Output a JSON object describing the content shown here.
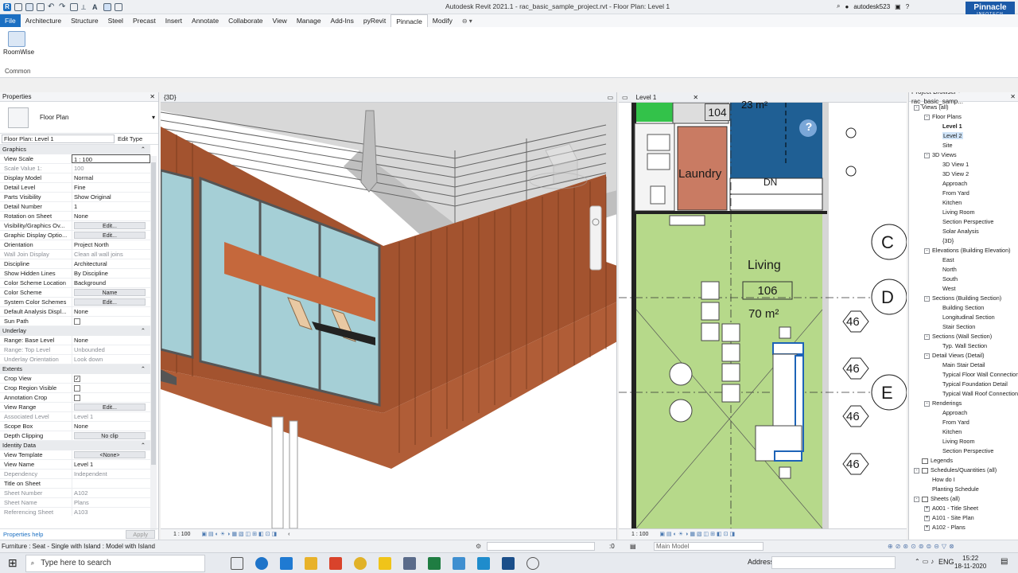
{
  "app": {
    "title": "Autodesk Revit 2021.1 - rac_basic_sample_project.rvt - Floor Plan: Level 1",
    "user": "autodesk523",
    "brand": "Pinnacle",
    "brand_sub": "INFOTECH"
  },
  "tabs": [
    "Architecture",
    "Structure",
    "Steel",
    "Precast",
    "Insert",
    "Annotate",
    "Collaborate",
    "View",
    "Manage",
    "Add-Ins",
    "pyRevit",
    "Pinnacle",
    "Modify"
  ],
  "file_tab": "File",
  "active_tab": "Pinnacle",
  "ribbon": {
    "tool_label": "RoomWise",
    "panel_label": "Common"
  },
  "properties": {
    "header": "Properties",
    "type_name": "Floor Plan",
    "selector": "Floor Plan: Level 1",
    "edit_type": "Edit Type",
    "sections": [
      {
        "name": "Graphics",
        "rows": [
          {
            "n": "View Scale",
            "v": "1 : 100",
            "kind": "input"
          },
          {
            "n": "Scale Value    1:",
            "v": "100",
            "kind": "grey"
          },
          {
            "n": "Display Model",
            "v": "Normal"
          },
          {
            "n": "Detail Level",
            "v": "Fine"
          },
          {
            "n": "Parts Visibility",
            "v": "Show Original"
          },
          {
            "n": "Detail Number",
            "v": "1"
          },
          {
            "n": "Rotation on Sheet",
            "v": "None"
          },
          {
            "n": "Visibility/Graphics Ov...",
            "v": "Edit...",
            "kind": "btn"
          },
          {
            "n": "Graphic Display Optio...",
            "v": "Edit...",
            "kind": "btn"
          },
          {
            "n": "Orientation",
            "v": "Project North"
          },
          {
            "n": "Wall Join Display",
            "v": "Clean all wall joins",
            "kind": "grey"
          },
          {
            "n": "Discipline",
            "v": "Architectural"
          },
          {
            "n": "Show Hidden Lines",
            "v": "By Discipline"
          },
          {
            "n": "Color Scheme Location",
            "v": "Background"
          },
          {
            "n": "Color Scheme",
            "v": "Name",
            "kind": "btn"
          },
          {
            "n": "System Color Schemes",
            "v": "Edit...",
            "kind": "btn"
          },
          {
            "n": "Default Analysis Displ...",
            "v": "None"
          },
          {
            "n": "Sun Path",
            "v": "",
            "kind": "check"
          }
        ]
      },
      {
        "name": "Underlay",
        "rows": [
          {
            "n": "Range: Base Level",
            "v": "None"
          },
          {
            "n": "Range: Top Level",
            "v": "Unbounded",
            "kind": "grey"
          },
          {
            "n": "Underlay Orientation",
            "v": "Look down",
            "kind": "grey"
          }
        ]
      },
      {
        "name": "Extents",
        "rows": [
          {
            "n": "Crop View",
            "v": "",
            "kind": "checked"
          },
          {
            "n": "Crop Region Visible",
            "v": "",
            "kind": "check"
          },
          {
            "n": "Annotation Crop",
            "v": "",
            "kind": "check"
          },
          {
            "n": "View Range",
            "v": "Edit...",
            "kind": "btn"
          },
          {
            "n": "Associated Level",
            "v": "Level 1",
            "kind": "grey"
          },
          {
            "n": "Scope Box",
            "v": "None"
          },
          {
            "n": "Depth Clipping",
            "v": "No clip",
            "kind": "btn"
          }
        ]
      },
      {
        "name": "Identity Data",
        "rows": [
          {
            "n": "View Template",
            "v": "<None>",
            "kind": "btn"
          },
          {
            "n": "View Name",
            "v": "Level 1"
          },
          {
            "n": "Dependency",
            "v": "Independent",
            "kind": "grey"
          },
          {
            "n": "Title on Sheet",
            "v": ""
          },
          {
            "n": "Sheet Number",
            "v": "A102",
            "kind": "grey"
          },
          {
            "n": "Sheet Name",
            "v": "Plans",
            "kind": "grey"
          },
          {
            "n": "Referencing Sheet",
            "v": "A103",
            "kind": "grey"
          }
        ]
      }
    ],
    "help_link": "Properties help",
    "apply": "Apply"
  },
  "view3d": {
    "tab": "{3D}",
    "scale": "1 : 100"
  },
  "viewplan": {
    "tab": "Level 1",
    "scale": "1 : 100",
    "laundry": "Laundry",
    "dn": "DN",
    "top_tag": "104",
    "area_top": "23 m²",
    "room_name": "Living",
    "room_number": "106",
    "room_area": "70 m²",
    "grid_c": "C",
    "grid_d": "D",
    "grid_e": "E",
    "tag_46": "46",
    "help": "?"
  },
  "browser": {
    "header": "Project Browser - rac_basic_samp...",
    "tree": [
      {
        "t": "Views (all)",
        "l": 0,
        "tog": "-"
      },
      {
        "t": "Floor Plans",
        "l": 1,
        "tog": "-"
      },
      {
        "t": "Level 1",
        "l": 2,
        "b": true
      },
      {
        "t": "Level 2",
        "l": 2,
        "sel": true
      },
      {
        "t": "Site",
        "l": 2
      },
      {
        "t": "3D Views",
        "l": 1,
        "tog": "-"
      },
      {
        "t": "3D View 1",
        "l": 2
      },
      {
        "t": "3D View 2",
        "l": 2
      },
      {
        "t": "Approach",
        "l": 2
      },
      {
        "t": "From Yard",
        "l": 2
      },
      {
        "t": "Kitchen",
        "l": 2
      },
      {
        "t": "Living Room",
        "l": 2
      },
      {
        "t": "Section Perspective",
        "l": 2
      },
      {
        "t": "Solar Analysis",
        "l": 2
      },
      {
        "t": "{3D}",
        "l": 2
      },
      {
        "t": "Elevations (Building Elevation)",
        "l": 1,
        "tog": "-"
      },
      {
        "t": "East",
        "l": 2
      },
      {
        "t": "North",
        "l": 2
      },
      {
        "t": "South",
        "l": 2
      },
      {
        "t": "West",
        "l": 2
      },
      {
        "t": "Sections (Building Section)",
        "l": 1,
        "tog": "-"
      },
      {
        "t": "Building Section",
        "l": 2
      },
      {
        "t": "Longitudinal Section",
        "l": 2
      },
      {
        "t": "Stair Section",
        "l": 2
      },
      {
        "t": "Sections (Wall Section)",
        "l": 1,
        "tog": "-"
      },
      {
        "t": "Typ. Wall Section",
        "l": 2
      },
      {
        "t": "Detail Views (Detail)",
        "l": 1,
        "tog": "-"
      },
      {
        "t": "Main Stair Detail",
        "l": 2
      },
      {
        "t": "Typical Floor Wall Connection",
        "l": 2
      },
      {
        "t": "Typical Foundation Detail",
        "l": 2
      },
      {
        "t": "Typical Wall Roof Connection",
        "l": 2
      },
      {
        "t": "Renderings",
        "l": 1,
        "tog": "-"
      },
      {
        "t": "Approach",
        "l": 2
      },
      {
        "t": "From Yard",
        "l": 2
      },
      {
        "t": "Kitchen",
        "l": 2
      },
      {
        "t": "Living Room",
        "l": 2
      },
      {
        "t": "Section Perspective",
        "l": 2
      },
      {
        "t": "Legends",
        "l": 0,
        "icon": true
      },
      {
        "t": "Schedules/Quantities (all)",
        "l": 0,
        "tog": "-",
        "icon": true
      },
      {
        "t": "How do I",
        "l": 1
      },
      {
        "t": "Planting Schedule",
        "l": 1
      },
      {
        "t": "Sheets (all)",
        "l": 0,
        "tog": "-",
        "icon": true
      },
      {
        "t": "A001 - Title Sheet",
        "l": 1,
        "tog": "+"
      },
      {
        "t": "A101 - Site Plan",
        "l": 1,
        "tog": "+"
      },
      {
        "t": "A102 - Plans",
        "l": 1,
        "tog": "+"
      }
    ]
  },
  "status": {
    "left": "Furniture : Seat - Single with Island : Model with Island",
    "zero": ":0",
    "model": "Main Model"
  },
  "taskbar": {
    "search": "Type here to search",
    "address": "Address",
    "lang": "ENG",
    "time": "15:22",
    "date": "18-11-2020"
  },
  "colors": {
    "wood": "#a3532f",
    "green": "#b6d98a",
    "blue": "#1f5f94",
    "brand": "#1b5aa8"
  }
}
